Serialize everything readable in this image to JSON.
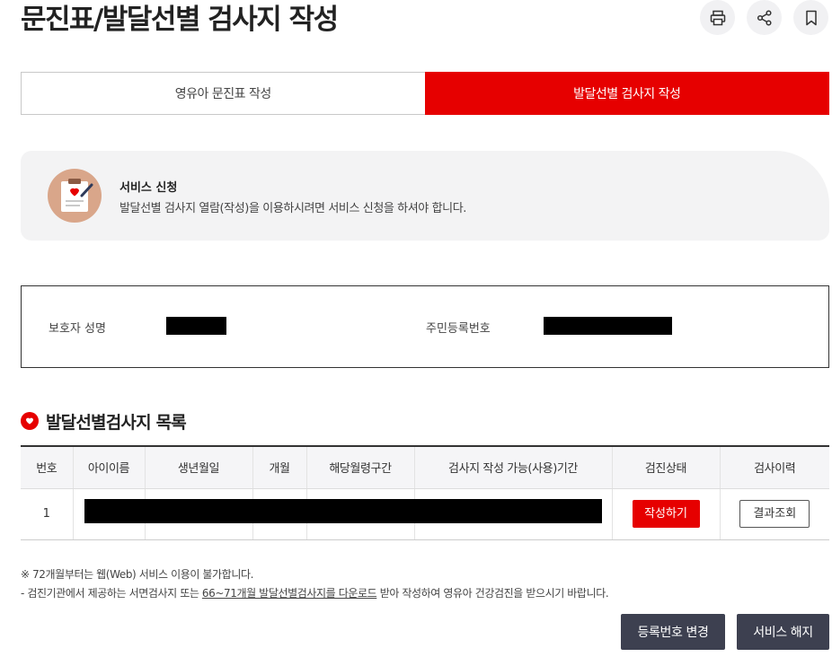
{
  "page": {
    "title": "문진표/발달선별 검사지 작성"
  },
  "toolbar": [
    {
      "icon": "print-icon"
    },
    {
      "icon": "share-icon"
    },
    {
      "icon": "bookmark-icon"
    }
  ],
  "tabs": [
    {
      "label": "영유아 문진표 작성",
      "active": false
    },
    {
      "label": "발달선별 검사지 작성",
      "active": true
    }
  ],
  "notice": {
    "icon": "clipboard-heart-icon",
    "title": "서비스 신청",
    "desc": "발달선별 검사지 열람(작성)을 이용하시려면 서비스 신청을 하셔야 합니다."
  },
  "info": {
    "guardian_label": "보호자 성명",
    "rrn_label": "주민등록번호"
  },
  "section": {
    "title": "발달선별검사지 목록",
    "icon": "heart-icon"
  },
  "table": {
    "headers": [
      "번호",
      "아이이름",
      "생년월일",
      "개월",
      "해당월령구간",
      "검사지 작성 가능(사용)기간",
      "검진상태",
      "검사이력"
    ],
    "rows": [
      {
        "no": "1",
        "status_btn": "작성하기",
        "history_btn": "결과조회"
      }
    ]
  },
  "notes": {
    "line1": "※ 72개월부터는 웹(Web) 서비스 이용이 불가합니다.",
    "line2_prefix": "- 검진기관에서 제공하는 서면검사지 또는 ",
    "line2_link": "66~71개월 발달선별검사지를 다운로드",
    "line2_suffix": " 받아 작성하여 영유아 건강검진을 받으시기 바랍니다."
  },
  "buttons": {
    "change_reg": "등록번호 변경",
    "cancel_service": "서비스 해지"
  },
  "colors": {
    "accent": "#e60000",
    "dark_button": "#3d4050",
    "notice_bg": "#f3f3f4"
  }
}
